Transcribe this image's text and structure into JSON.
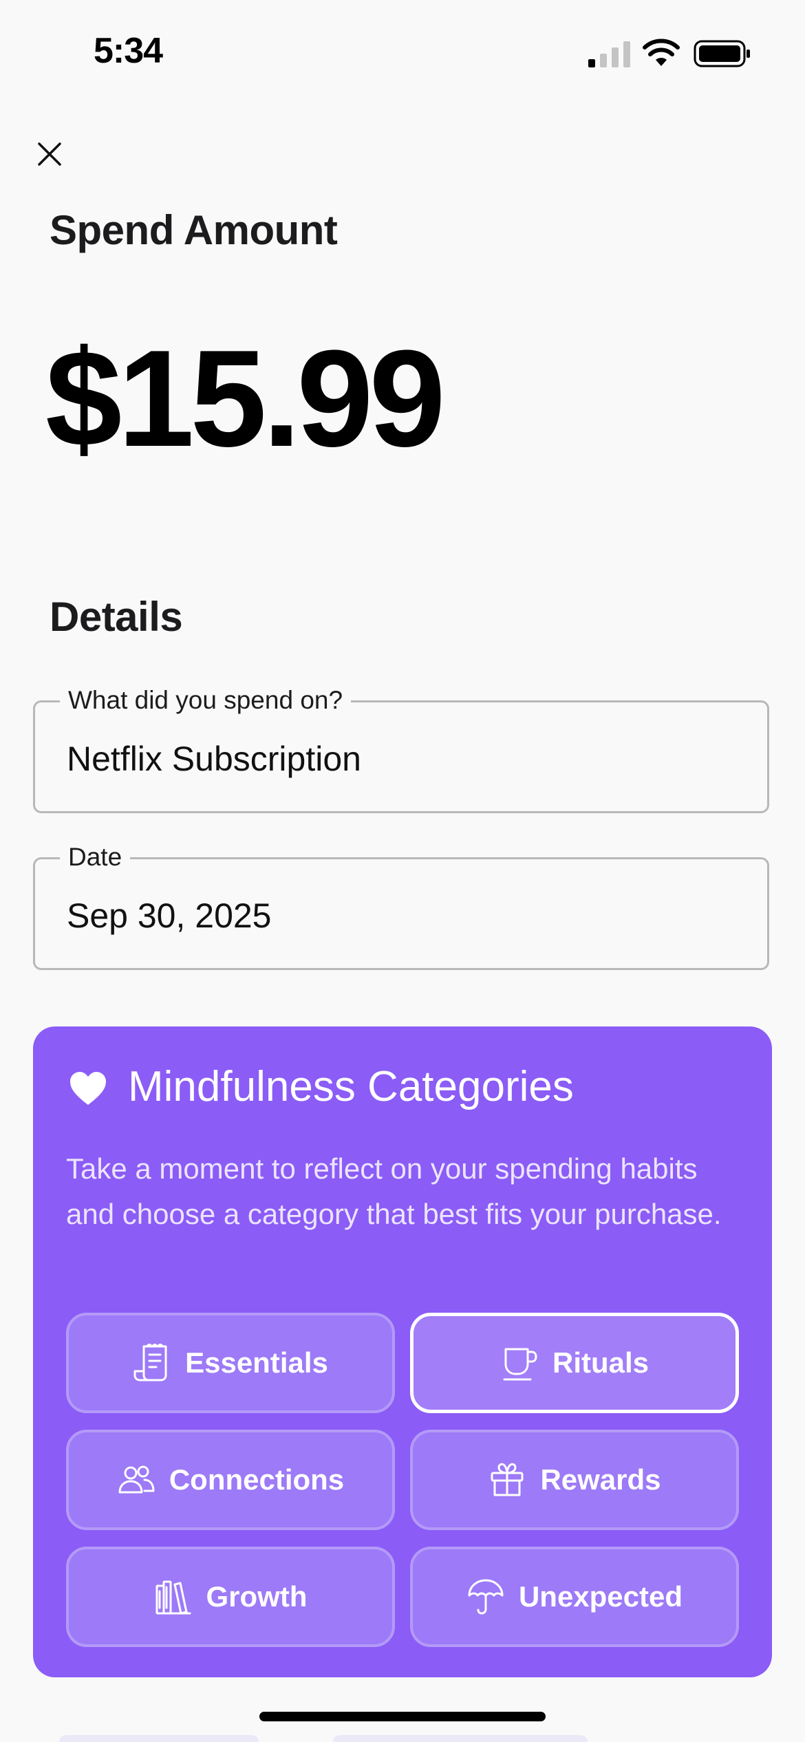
{
  "status_bar": {
    "time": "5:34"
  },
  "spend": {
    "title": "Spend Amount",
    "amount": "$15.99"
  },
  "details": {
    "title": "Details",
    "description_field": {
      "label": "What did you spend on?",
      "value": "Netflix Subscription"
    },
    "date_field": {
      "label": "Date",
      "value": "Sep 30, 2025"
    }
  },
  "mindfulness": {
    "title": "Mindfulness Categories",
    "description": "Take a moment to reflect on your spending habits and choose a category that best fits your purchase.",
    "accent_color": "#8b5cf6",
    "selected": "Rituals",
    "categories": [
      {
        "label": "Essentials",
        "icon": "receipt-icon"
      },
      {
        "label": "Rituals",
        "icon": "coffee-cup-icon"
      },
      {
        "label": "Connections",
        "icon": "users-icon"
      },
      {
        "label": "Rewards",
        "icon": "gift-icon"
      },
      {
        "label": "Growth",
        "icon": "books-icon"
      },
      {
        "label": "Unexpected",
        "icon": "umbrella-icon"
      }
    ]
  }
}
